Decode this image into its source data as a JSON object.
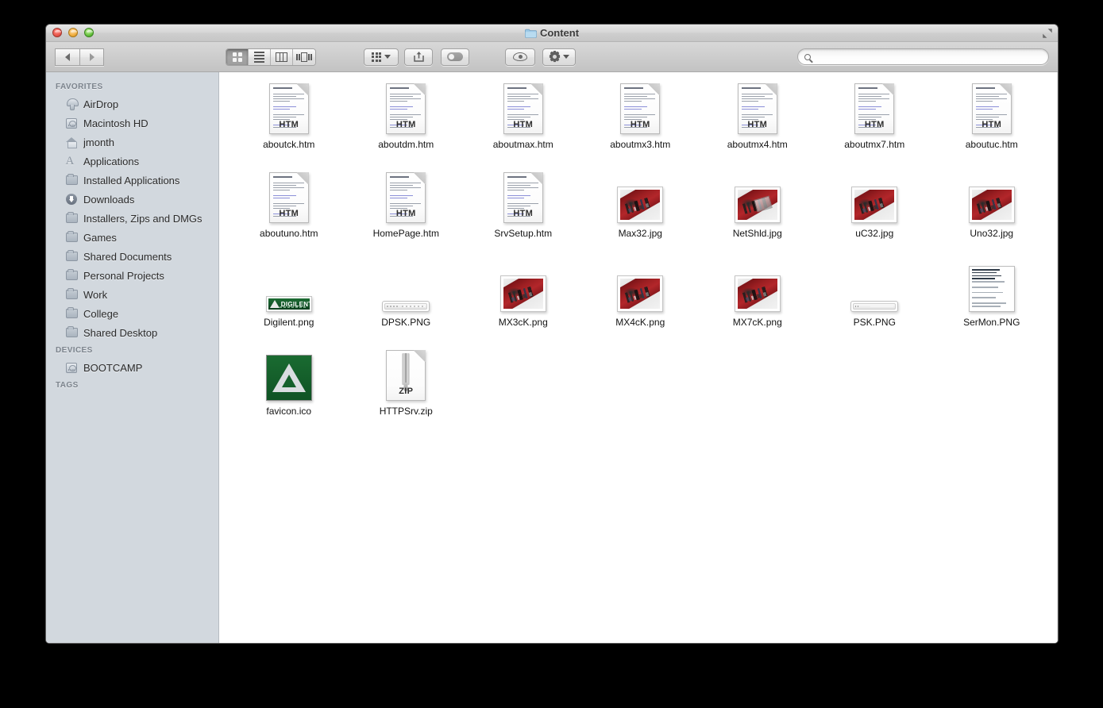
{
  "window": {
    "title": "Content",
    "title_icon": "folder-icon",
    "traffic_lights": [
      "close",
      "minimize",
      "maximize"
    ]
  },
  "toolbar": {
    "back_label": "Back",
    "forward_label": "Forward",
    "view_modes": [
      {
        "name": "icon-view",
        "label": "Icon View",
        "active": true
      },
      {
        "name": "list-view",
        "label": "List View",
        "active": false
      },
      {
        "name": "column-view",
        "label": "Column View",
        "active": false
      },
      {
        "name": "coverflow-view",
        "label": "Cover Flow View",
        "active": false
      }
    ],
    "arrange_label": "Arrange",
    "share_label": "Share",
    "tag_label": "Edit Tags",
    "quicklook_label": "Quick Look",
    "action_label": "Action",
    "fullscreen_label": "Enter Full Screen"
  },
  "search": {
    "value": "",
    "placeholder": ""
  },
  "sidebar": {
    "sections": [
      {
        "header": "FAVORITES",
        "items": [
          {
            "label": "AirDrop",
            "icon": "airdrop-icon"
          },
          {
            "label": "Macintosh HD",
            "icon": "hard-drive-icon"
          },
          {
            "label": "jmonth",
            "icon": "home-icon"
          },
          {
            "label": "Applications",
            "icon": "applications-icon"
          },
          {
            "label": "Installed Applications",
            "icon": "folder-icon"
          },
          {
            "label": "Downloads",
            "icon": "downloads-icon"
          },
          {
            "label": "Installers, Zips and DMGs",
            "icon": "folder-icon"
          },
          {
            "label": "Games",
            "icon": "folder-icon"
          },
          {
            "label": "Shared Documents",
            "icon": "folder-icon"
          },
          {
            "label": "Personal Projects",
            "icon": "folder-icon"
          },
          {
            "label": "Work",
            "icon": "folder-icon"
          },
          {
            "label": "College",
            "icon": "folder-icon"
          },
          {
            "label": "Shared Desktop",
            "icon": "folder-icon"
          }
        ]
      },
      {
        "header": "DEVICES",
        "items": [
          {
            "label": "BOOTCAMP",
            "icon": "hard-drive-icon"
          }
        ]
      },
      {
        "header": "TAGS",
        "items": []
      }
    ]
  },
  "files": [
    {
      "name": "aboutck.htm",
      "kind": "document",
      "badge": "HTM"
    },
    {
      "name": "aboutdm.htm",
      "kind": "document",
      "badge": "HTM"
    },
    {
      "name": "aboutmax.htm",
      "kind": "document",
      "badge": "HTM"
    },
    {
      "name": "aboutmx3.htm",
      "kind": "document",
      "badge": "HTM"
    },
    {
      "name": "aboutmx4.htm",
      "kind": "document",
      "badge": "HTM"
    },
    {
      "name": "aboutmx7.htm",
      "kind": "document",
      "badge": "HTM"
    },
    {
      "name": "aboutuc.htm",
      "kind": "document",
      "badge": "HTM"
    },
    {
      "name": "aboutuno.htm",
      "kind": "document",
      "badge": "HTM"
    },
    {
      "name": "HomePage.htm",
      "kind": "document",
      "badge": "HTM"
    },
    {
      "name": "SrvSetup.htm",
      "kind": "document",
      "badge": "HTM"
    },
    {
      "name": "Max32.jpg",
      "kind": "photo-pcb",
      "badge": ""
    },
    {
      "name": "NetShld.jpg",
      "kind": "photo-pcb-net",
      "badge": ""
    },
    {
      "name": "uC32.jpg",
      "kind": "photo-pcb",
      "badge": ""
    },
    {
      "name": "Uno32.jpg",
      "kind": "photo-pcb",
      "badge": ""
    },
    {
      "name": "Digilent.png",
      "kind": "banner-logo",
      "badge": ""
    },
    {
      "name": "DPSK.PNG",
      "kind": "strip-wide",
      "badge": ""
    },
    {
      "name": "MX3cK.png",
      "kind": "photo-pcb",
      "badge": ""
    },
    {
      "name": "MX4cK.png",
      "kind": "photo-pcb",
      "badge": ""
    },
    {
      "name": "MX7cK.png",
      "kind": "photo-pcb",
      "badge": ""
    },
    {
      "name": "PSK.PNG",
      "kind": "strip-plain",
      "badge": ""
    },
    {
      "name": "SerMon.PNG",
      "kind": "textshot",
      "badge": ""
    },
    {
      "name": "favicon.ico",
      "kind": "favicon",
      "badge": ""
    },
    {
      "name": "HTTPSrv.zip",
      "kind": "archive",
      "badge": "ZIP"
    }
  ],
  "colors": {
    "sidebar_bg": "#d2d8de",
    "content_bg": "#ffffff",
    "titlebar_top": "#e8e8e8",
    "desktop_bg": "#000000",
    "section_header": "#7b838c",
    "accent_green": "#14572a"
  }
}
